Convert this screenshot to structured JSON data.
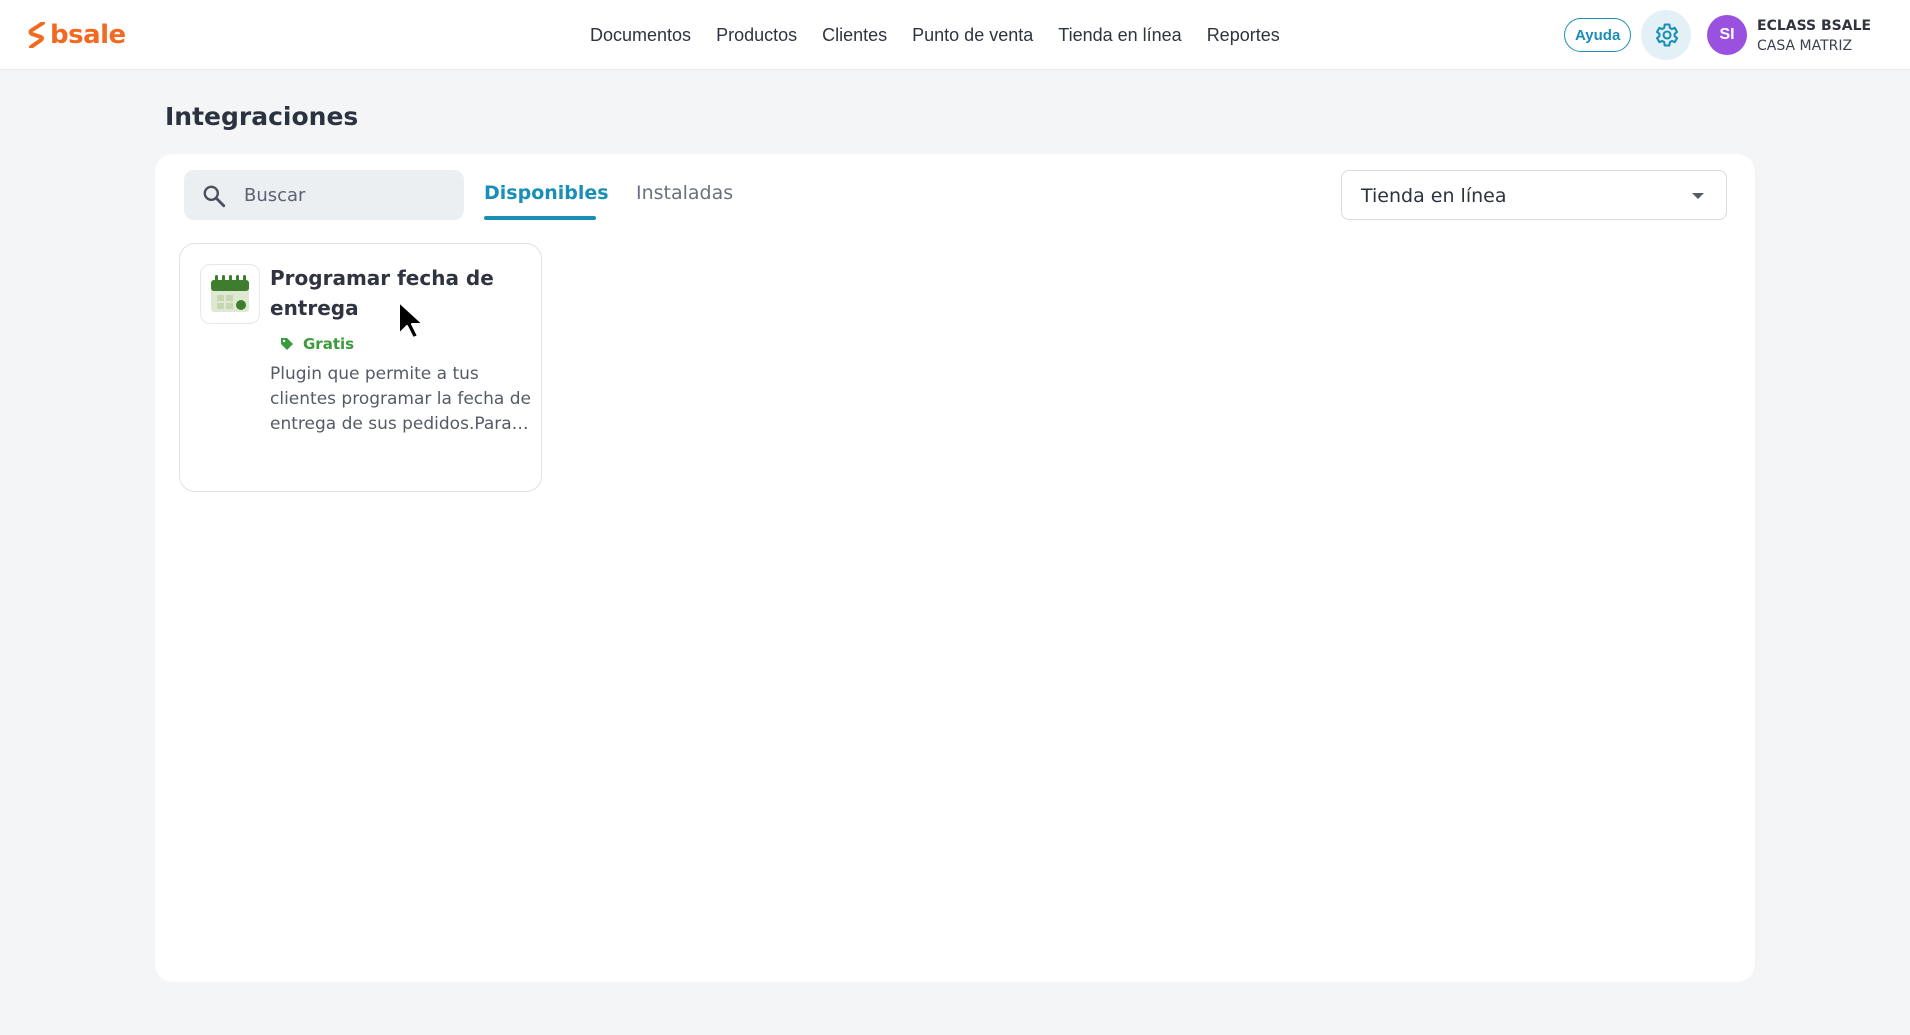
{
  "header": {
    "brand": "bsale",
    "nav": [
      "Documentos",
      "Productos",
      "Clientes",
      "Punto de venta",
      "Tienda en línea",
      "Reportes"
    ],
    "help_label": "Ayuda",
    "avatar_initials": "SI",
    "account_name": "ECLASS BSALE",
    "account_branch": "CASA MATRIZ"
  },
  "page": {
    "title": "Integraciones"
  },
  "search": {
    "placeholder": "Buscar",
    "value": ""
  },
  "tabs": {
    "active": "Disponibles",
    "inactive": "Instaladas"
  },
  "filter": {
    "selected": "Tienda en línea"
  },
  "integrations": [
    {
      "title": "Programar fecha de entrega",
      "price": "Gratis",
      "description": "Plugin que permite a tus clientes programar la fecha de entrega de sus pedidos.Para…"
    }
  ],
  "colors": {
    "brand": "#f26a21",
    "accent": "#1a8fb5",
    "free_green": "#3a9b3c",
    "avatar": "#9b51e0"
  },
  "icons": [
    "bsale-logo-icon",
    "gear-icon",
    "search-icon",
    "chevron-down-icon",
    "calendar-icon",
    "tag-icon",
    "mouse-cursor-icon"
  ]
}
